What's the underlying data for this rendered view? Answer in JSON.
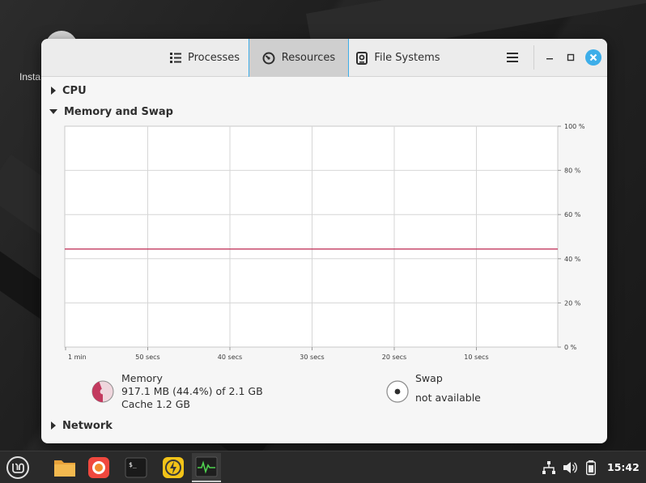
{
  "desktop": {
    "icon_label": "Insta"
  },
  "window": {
    "tabs": [
      {
        "label": "Processes",
        "icon": "list-icon"
      },
      {
        "label": "Resources",
        "icon": "gauge-icon"
      },
      {
        "label": "File Systems",
        "icon": "drive-icon"
      }
    ],
    "active_tab": "Resources"
  },
  "sections": {
    "cpu": "CPU",
    "memory": "Memory and Swap",
    "network": "Network"
  },
  "graph": {
    "y_ticks": [
      "100 %",
      "80 %",
      "60 %",
      "40 %",
      "20 %",
      "0 %"
    ],
    "x_ticks": [
      "1 min",
      "50 secs",
      "40 secs",
      "30 secs",
      "20 secs",
      "10 secs"
    ],
    "line_color": "#c33a5f"
  },
  "chart_data": {
    "type": "line",
    "title": "",
    "xlabel": "",
    "ylabel": "",
    "x_tick_labels": [
      "1 min",
      "50 secs",
      "40 secs",
      "30 secs",
      "20 secs",
      "10 secs"
    ],
    "y_tick_labels": [
      "100 %",
      "80 %",
      "60 %",
      "40 %",
      "20 %",
      "0 %"
    ],
    "ylim": [
      0,
      100
    ],
    "xlim": [
      60,
      0
    ],
    "grid": true,
    "series": [
      {
        "x": [
          60,
          0
        ],
        "values": [
          44.4,
          44.4
        ],
        "color": "#c33a5f"
      }
    ]
  },
  "memory": {
    "title": "Memory",
    "usage": "917.1 MB (44.4%) of 2.1 GB",
    "cache": "Cache 1.2 GB",
    "fraction": 0.444,
    "color": "#c33a5f"
  },
  "swap": {
    "title": "Swap",
    "status": "not available"
  },
  "taskbar": {
    "clock": "15:42",
    "apps": [
      "mint-menu-icon",
      "files-icon",
      "firefox-icon",
      "terminal-icon",
      "update-manager-icon",
      "system-monitor-icon"
    ]
  }
}
